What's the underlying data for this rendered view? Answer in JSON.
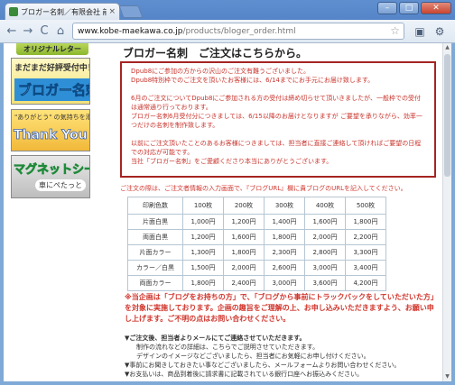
{
  "browser": {
    "tab_title": "ブロガー名刺／有限会社 前",
    "tab_close": "×",
    "url_host": "www.kobe-maekawa.co.jp",
    "url_path": "/products/bloger_order.html",
    "nav": {
      "back": "←",
      "forward": "→",
      "reload": "C",
      "home": "⌂"
    },
    "star": "☆",
    "win_minimize": "–",
    "win_maximize": "□",
    "win_close": "✕"
  },
  "sidebar": {
    "top_label": "オリジナルレター",
    "banner1": {
      "line1": "まだまだ好評受付中！",
      "line2": "ブロガー名刺"
    },
    "banner2": {
      "line1": "\"ありがとう\" の気持ちを添えて…",
      "line2": "Thank You 封筒"
    },
    "banner3": {
      "line1": "マグネットシート",
      "line2": "車にぺたっと"
    }
  },
  "main": {
    "title": "ブロガー名刺　ご注文はこちらから。",
    "notice": [
      "Dpub8にご参加の方からの沢山のご注文有難うございました。",
      "Dpub8特別枠でのご注文を頂いたお客様には、6/14までにお手元にお届け致します。",
      "",
      "6月のご注文についてDpub8にご参加される方の受付は締め切らせて頂いきましたが、一般枠での受付は通常通り行っております。",
      "ブロガー名刺6月受付分につきましては、6/15以降のお届けとなりますが ご要望を承りながら、効率一つだけの名刺を制作致します。",
      "",
      "以前にご注文頂いたことのあるお客様につきましては、担当者に直接ご連絡して頂ければご要望の日程での対応が可能です。",
      "当社「ブロガー名刺」をご愛顧くださり本当にありがとうございます。"
    ],
    "intro": "ご注文の際は、ご注文者情報の入力画面で、『ブログURL』欄に貴ブログのURLを記入してください。",
    "table": {
      "header": [
        "印刷色数",
        "100枚",
        "200枚",
        "300枚",
        "400枚",
        "500枚"
      ],
      "rows": [
        [
          "片面白黒",
          "1,000円",
          "1,200円",
          "1,400円",
          "1,600円",
          "1,800円"
        ],
        [
          "両面白黒",
          "1,200円",
          "1,600円",
          "1,800円",
          "2,000円",
          "2,200円"
        ],
        [
          "片面カラー",
          "1,300円",
          "1,800円",
          "2,300円",
          "2,800円",
          "3,300円"
        ],
        [
          "カラー／白黒",
          "1,500円",
          "2,000円",
          "2,600円",
          "3,000円",
          "3,400円"
        ],
        [
          "両面カラー",
          "1,800円",
          "2,400円",
          "3,000円",
          "3,600円",
          "4,200円"
        ]
      ]
    },
    "campaign": "※当企画は「ブログをお持ちの方」で、「ブログから事前にトラックバックをしていただいた方」を対象に実施しております。企画の趣旨をご理解の上、お申し込みいただきますよう、お願い申し上げます。ご不明の点はお問い合わせください。",
    "bullets": {
      "head": "▼ご注文後、担当者よりメールにてご連絡させていただきます。",
      "b1": "　制作の流れなどの詳細は、こちらでご説明させていただきます。",
      "b2": "　デザインのイメージなどございましたら、担当者にお気軽にお申し付けください。",
      "b3": "▼事前にお聞きしておきたい事などございましたら、メールフォームよりお問い合わせください。",
      "b4": "▼お支払いは、商品到着後に請求書に記載されている銀行口座へお振込みください。"
    }
  }
}
